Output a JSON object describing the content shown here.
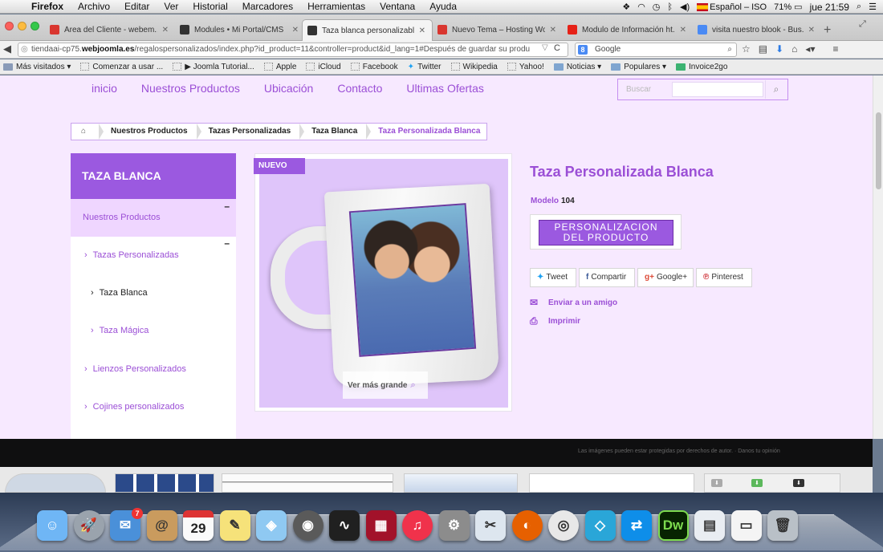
{
  "menubar": {
    "app": "Firefox",
    "items": [
      "Archivo",
      "Editar",
      "Ver",
      "Historial",
      "Marcadores",
      "Herramientas",
      "Ventana",
      "Ayuda"
    ],
    "input_source": "Español – ISO",
    "battery": "71%",
    "clock": "jue 21:59"
  },
  "tabs": [
    {
      "title": "Área del Cliente - webem...",
      "favicon_color": "#d9362f"
    },
    {
      "title": "Modules • Mi Portal/CMS",
      "favicon_color": "#333333"
    },
    {
      "title": "Taza blanca personalizable",
      "favicon_color": "#333333"
    },
    {
      "title": "Nuevo Tema – Hosting Wo...",
      "favicon_color": "#d9362f"
    },
    {
      "title": "Modulo de Información ht...",
      "favicon_color": "#e62117"
    },
    {
      "title": "visita nuestro blook - Bus...",
      "favicon_color": "#4a8af4"
    }
  ],
  "address": {
    "prefix": "tiendaai-cp75.",
    "domain": "webjoomla.es",
    "path": "/regalospersonalizados/index.php?id_product=11&controller=product&id_lang=1#Después de guardar su produ"
  },
  "search_engine": {
    "badge": "8",
    "placeholder": "Google"
  },
  "bookmarks": [
    {
      "label": "Más visitados ▾",
      "kind": "special"
    },
    {
      "label": "Comenzar a usar ...",
      "kind": "page"
    },
    {
      "label": "▶ Joomla Tutorial...",
      "kind": "page"
    },
    {
      "label": "Apple",
      "kind": "page"
    },
    {
      "label": "iCloud",
      "kind": "page"
    },
    {
      "label": "Facebook",
      "kind": "page"
    },
    {
      "label": "Twitter",
      "kind": "twitter"
    },
    {
      "label": "Wikipedia",
      "kind": "page"
    },
    {
      "label": "Yahoo!",
      "kind": "page"
    },
    {
      "label": "Noticias ▾",
      "kind": "folder"
    },
    {
      "label": "Populares ▾",
      "kind": "folder"
    },
    {
      "label": "Invoice2go",
      "kind": "invoice"
    }
  ],
  "site": {
    "nav": [
      "inicio",
      "Nuestros Productos",
      "Ubicación",
      "Contacto",
      "Ultimas Ofertas"
    ],
    "search_placeholder": "Buscar",
    "breadcrumb": [
      "Nuestros Productos",
      "Tazas Personalizadas",
      "Taza Blanca",
      "Taza Personalizada Blanca"
    ],
    "sidebar": {
      "title": "TAZA BLANCA",
      "top_item": "Nuestros Productos",
      "items": [
        {
          "label": "Tazas Personalizadas",
          "level": 1
        },
        {
          "label": "Taza Blanca",
          "level": 2
        },
        {
          "label": "Taza Mágica",
          "level": 2
        },
        {
          "label": "Lienzos Personalizados",
          "level": 1
        },
        {
          "label": "Cojines personalizados",
          "level": 1
        }
      ]
    },
    "product": {
      "badge": "NUEVO",
      "view_larger": "Ver más grande",
      "name": "Taza Personalizada Blanca",
      "model_label": "Modelo",
      "model_value": "104",
      "customize_button": [
        "PERSONALIZACION",
        "DEL PRODUCTO"
      ],
      "share": [
        "Tweet",
        "Compartir",
        "Google+",
        "Pinterest"
      ],
      "send_friend": "Enviar a un amigo",
      "print": "Imprimir"
    },
    "footer_note": "Las imágenes pueden estar protegidas por derechos de autor. · Danos tu opinión"
  },
  "colors": {
    "accent": "#9b59e0",
    "accent_text": "#9b4fd6",
    "page_bg": "#f7e9ff",
    "sidebar_active": "#efd6ff"
  },
  "dock": {
    "calendar_day": "29",
    "dw_label": "Dw",
    "apps": [
      "finder",
      "launchpad",
      "mail",
      "contacts",
      "calendar",
      "notes",
      "maps",
      "facetime",
      "activity-monitor",
      "photo-booth",
      "itunes",
      "system-preferences",
      "preview",
      "firefox",
      "chrome",
      "xcode",
      "teamviewer",
      "dreamweaver",
      "downloads",
      "documents",
      "trash"
    ],
    "mail_badge": "7"
  }
}
